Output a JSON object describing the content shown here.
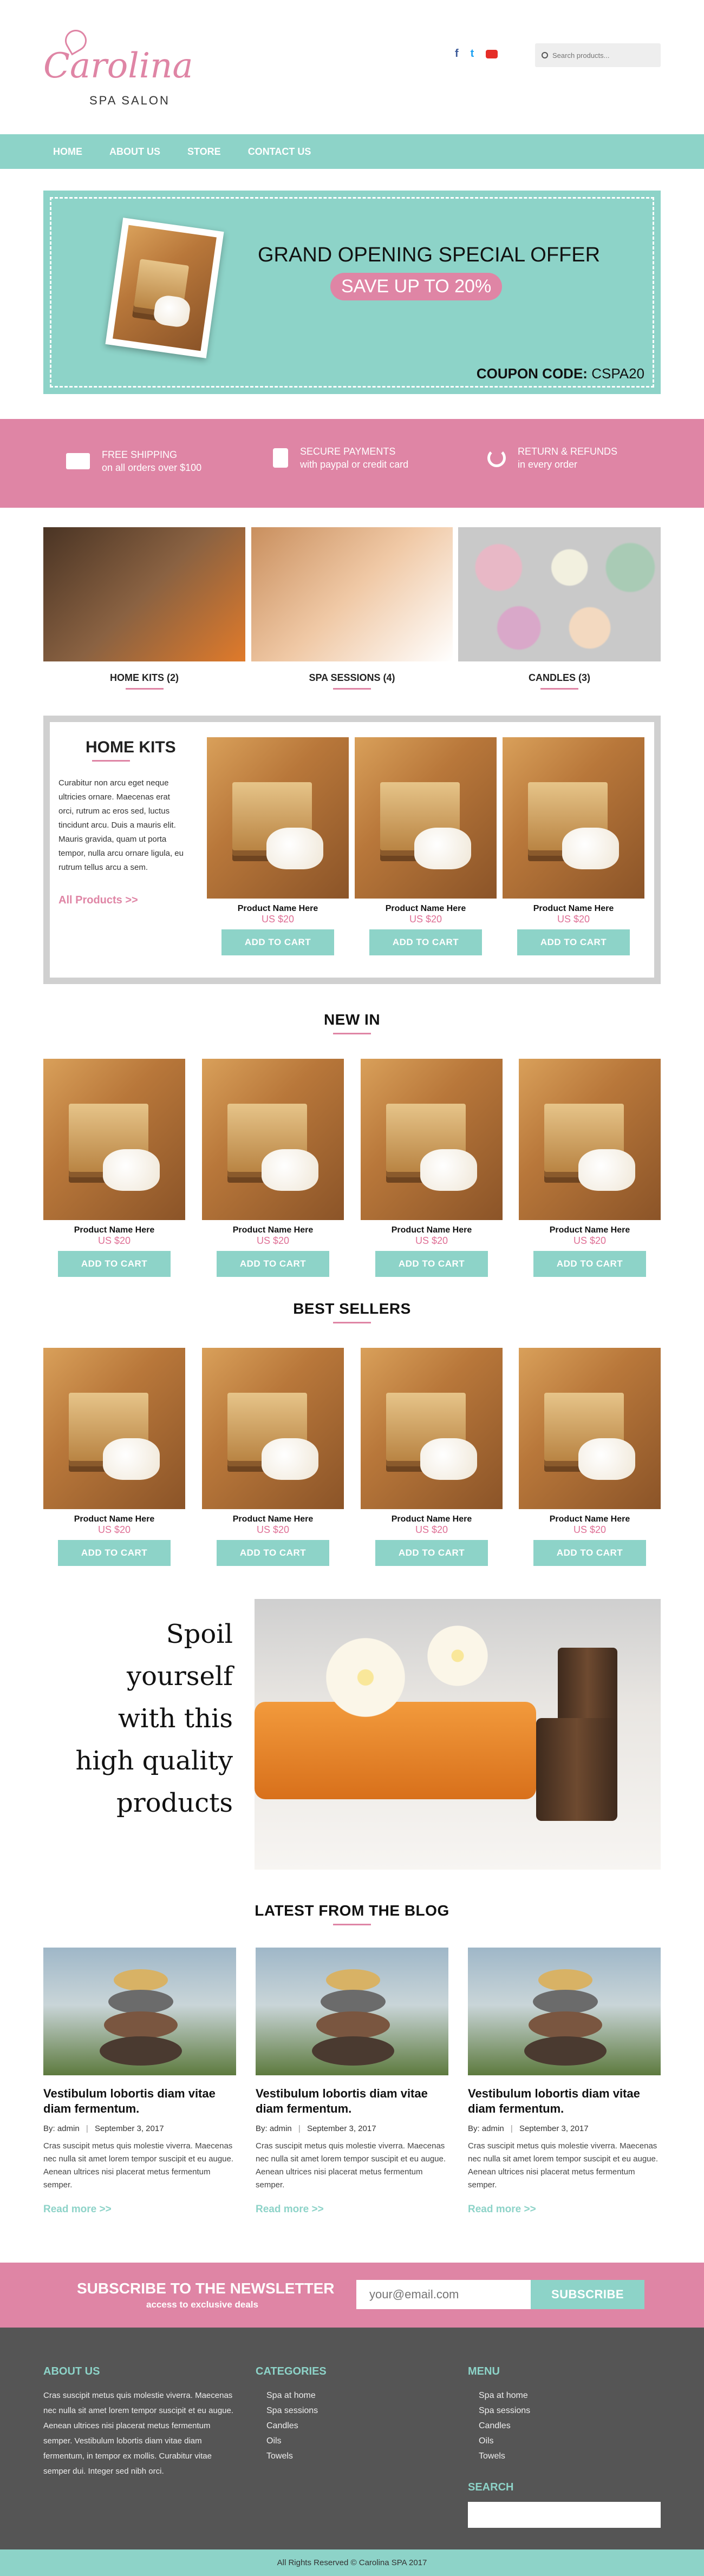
{
  "brand": {
    "name": "Carolina",
    "sub": "SPA SALON"
  },
  "search": {
    "placeholder": "Search products..."
  },
  "nav": [
    "HOME",
    "ABOUT US",
    "STORE",
    "CONTACT US"
  ],
  "hero": {
    "title": "GRAND OPENING SPECIAL OFFER",
    "badge": "SAVE UP TO 20%",
    "coupon_label": "COUPON CODE:",
    "coupon_code": "CSPA20"
  },
  "features": [
    {
      "title": "FREE SHIPPING",
      "sub": "on all orders over $100"
    },
    {
      "title": "SECURE PAYMENTS",
      "sub": "with paypal or credit card"
    },
    {
      "title": "RETURN & REFUNDS",
      "sub": "in every order"
    }
  ],
  "categories": [
    "HOME KITS (2)",
    "SPA SESSIONS (4)",
    "CANDLES (3)"
  ],
  "homekits": {
    "title": "HOME KITS",
    "text": "Curabitur non arcu eget neque ultricies ornare. Maecenas erat orci, rutrum ac eros sed, luctus tincidunt arcu. Duis a mauris elit. Mauris gravida, quam ut porta tempor, nulla arcu ornare ligula, eu rutrum tellus arcu a sem.",
    "link": "All Products >>"
  },
  "product": {
    "name": "Product Name Here",
    "price": "US $20",
    "cta": "ADD TO CART"
  },
  "sections": {
    "newin": "NEW IN",
    "best": "BEST SELLERS",
    "blog": "LATEST FROM THE BLOG"
  },
  "spoil": [
    "Spoil",
    "yourself",
    "with this",
    "high quality",
    "products"
  ],
  "blog": {
    "title": "Vestibulum lobortis diam vitae diam fermentum.",
    "by": "By: admin",
    "date": "September 3, 2017",
    "text": "Cras suscipit metus quis molestie viverra. Maecenas nec nulla sit amet lorem tempor suscipit et eu augue. Aenean ultrices nisi placerat metus fermentum semper.",
    "more": "Read more >>"
  },
  "newsletter": {
    "title": "SUBSCRIBE TO THE NEWSLETTER",
    "sub": "access to exclusive deals",
    "placeholder": "your@email.com",
    "button": "SUBSCRIBE"
  },
  "footer": {
    "about_title": "ABOUT US",
    "about_text": "Cras suscipit metus quis molestie viverra. Maecenas nec nulla sit amet lorem tempor suscipit et eu augue. Aenean ultrices nisi placerat metus fermentum semper. Vestibulum lobortis diam vitae diam fermentum, in tempor ex mollis. Curabitur vitae semper dui. Integer sed nibh orci.",
    "cat_title": "CATEGORIES",
    "cats": [
      "Spa at home",
      "Spa sessions",
      "Candles",
      "Oils",
      "Towels"
    ],
    "menu_title": "MENU",
    "menu": [
      "Spa at home",
      "Spa sessions",
      "Candles",
      "Oils",
      "Towels"
    ],
    "search_title": "SEARCH",
    "copyright": "All Rights Reserved © Carolina SPA 2017"
  },
  "colors": {
    "teal": "#8dd3c8",
    "pink": "#df85a5",
    "dark": "#555555"
  }
}
